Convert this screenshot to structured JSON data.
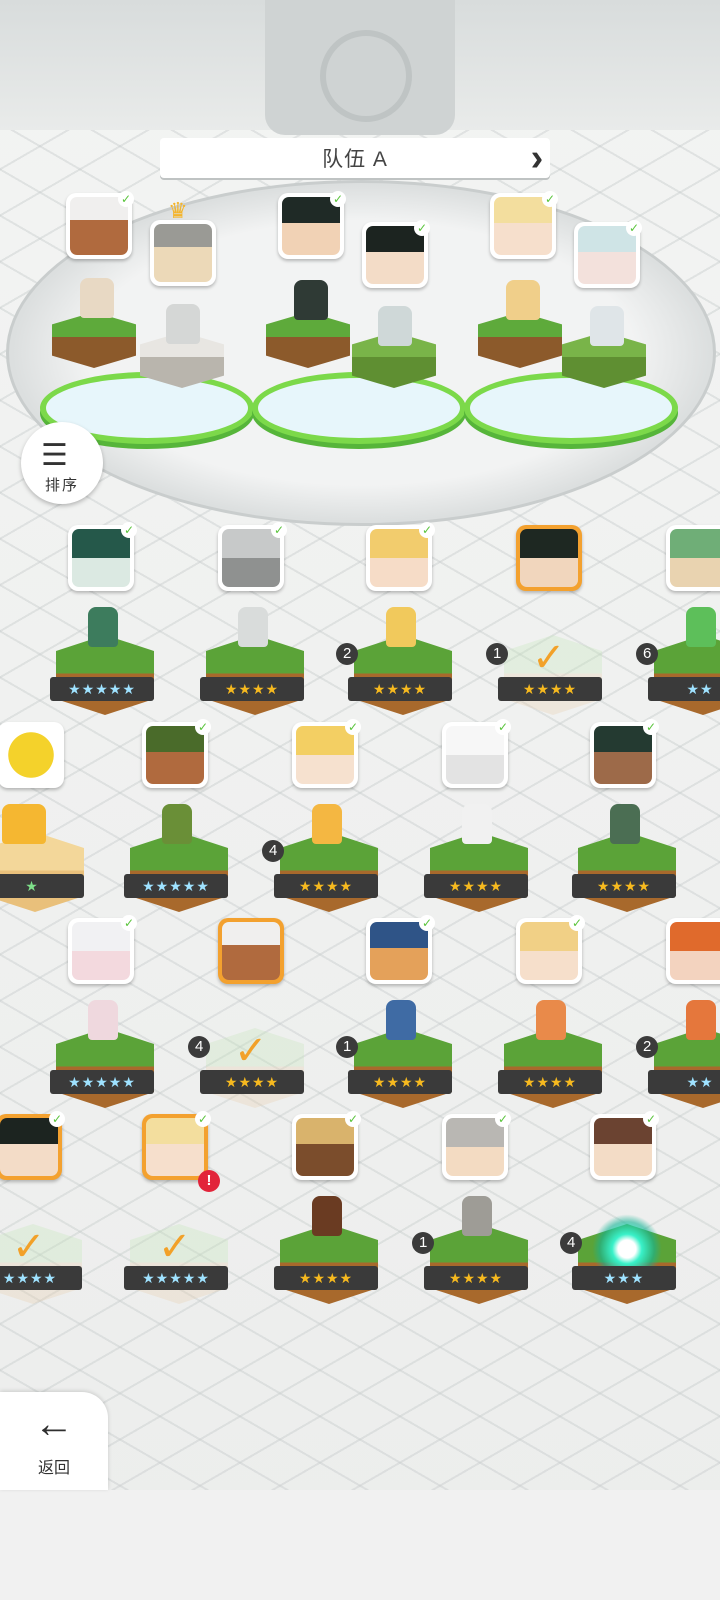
{
  "team": {
    "title": "队伍 A",
    "prev_icon": "chevron-left",
    "next_icon": "chevron-right"
  },
  "sort": {
    "label": "排序",
    "icon": "sort-icon"
  },
  "back": {
    "label": "返回",
    "icon": "arrow-left-icon"
  },
  "stars_label": {
    "three": "★★★",
    "four": "★★★★",
    "five": "★★★★★",
    "one": "★",
    "two": "★★"
  },
  "duplicates": {
    "r1c3": "2",
    "r1c4": "1",
    "r1c5": "6",
    "r2c2": "4",
    "r3c2": "4",
    "r3c3": "1",
    "r3c5": "2",
    "r4c4": "1",
    "r4c5": "4"
  },
  "colors": {
    "selected_border": "#f3a12f",
    "check": "#f2a129",
    "alert": "#e2243a",
    "slot_ring": "#7cd94a"
  }
}
